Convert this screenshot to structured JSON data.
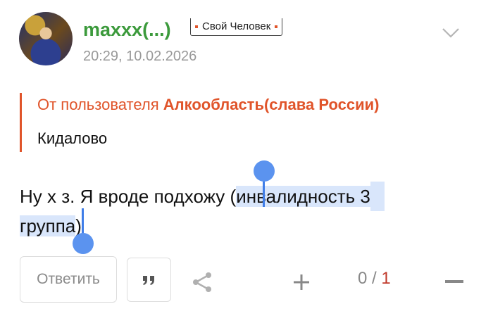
{
  "post": {
    "username": "maxxx(...)",
    "badge": "Свой Человек",
    "timestamp": "20:29, 10.02.2026",
    "quote": {
      "prefix": "От пользователя ",
      "author": "Алкообласть(слава России)",
      "text": "Кидалово"
    },
    "message": {
      "part1": "Ну х з. Я вроде подхожу (",
      "selected_line1": "инвалидность 3",
      "selected_line2": "группа",
      "part2": ")"
    }
  },
  "actions": {
    "reply_label": "Ответить",
    "rating_value": "0",
    "rating_sep": " / ",
    "rating_negative": "1"
  },
  "icons": {
    "chevron": "chevron-down-icon",
    "quote": "quote-icon",
    "share": "share-icon",
    "plus": "plus-icon",
    "minus": "minus-icon"
  },
  "colors": {
    "username": "#3c9a3c",
    "accent": "#e0542a",
    "selection": "#d9e6fb",
    "selection_handle": "#3f7de8",
    "negative": "#c0392b"
  }
}
